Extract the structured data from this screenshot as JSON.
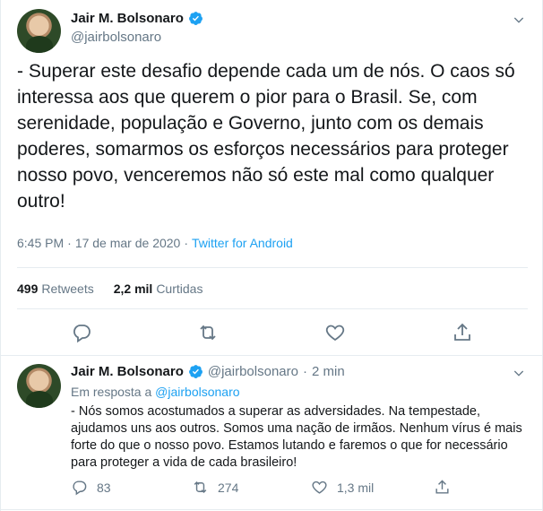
{
  "main_tweet": {
    "display_name": "Jair M. Bolsonaro",
    "handle": "@jairbolsonaro",
    "text": "- Superar este desafio depende cada um de nós. O caos só interessa aos que querem o pior para o Brasil. Se, com serenidade, população e Governo, junto com os demais poderes, somarmos os esforços necessários para proteger nosso povo, venceremos não só este mal como qualquer outro!",
    "time": "6:45 PM",
    "separator": "·",
    "date": "17 de mar de 2020",
    "source": "Twitter for Android",
    "retweets_count": "499",
    "retweets_label": "Retweets",
    "likes_count": "2,2 mil",
    "likes_label": "Curtidas"
  },
  "reply_tweet": {
    "display_name": "Jair M. Bolsonaro",
    "handle": "@jairbolsonaro",
    "dot": "·",
    "time": "2 min",
    "reply_prefix": "Em resposta a",
    "reply_mention": "@jairbolsonaro",
    "text": "- Nós somos acostumados a superar as adversidades. Na tempestade, ajudamos uns aos outros. Somos uma nação de irmãos. Nenhum vírus é mais forte do que o nosso povo. Estamos lutando e faremos o que for necessário para proteger a vida de cada brasileiro!",
    "replies": "83",
    "retweets": "274",
    "likes": "1,3 mil"
  },
  "icons": {
    "verified": "verified-badge-icon",
    "chevron": "chevron-down-icon",
    "reply": "reply-icon",
    "retweet": "retweet-icon",
    "like": "heart-icon",
    "share": "share-icon"
  },
  "colors": {
    "accent": "#1da1f2",
    "muted": "#657786",
    "text": "#14171a",
    "border": "#e6ecf0"
  }
}
